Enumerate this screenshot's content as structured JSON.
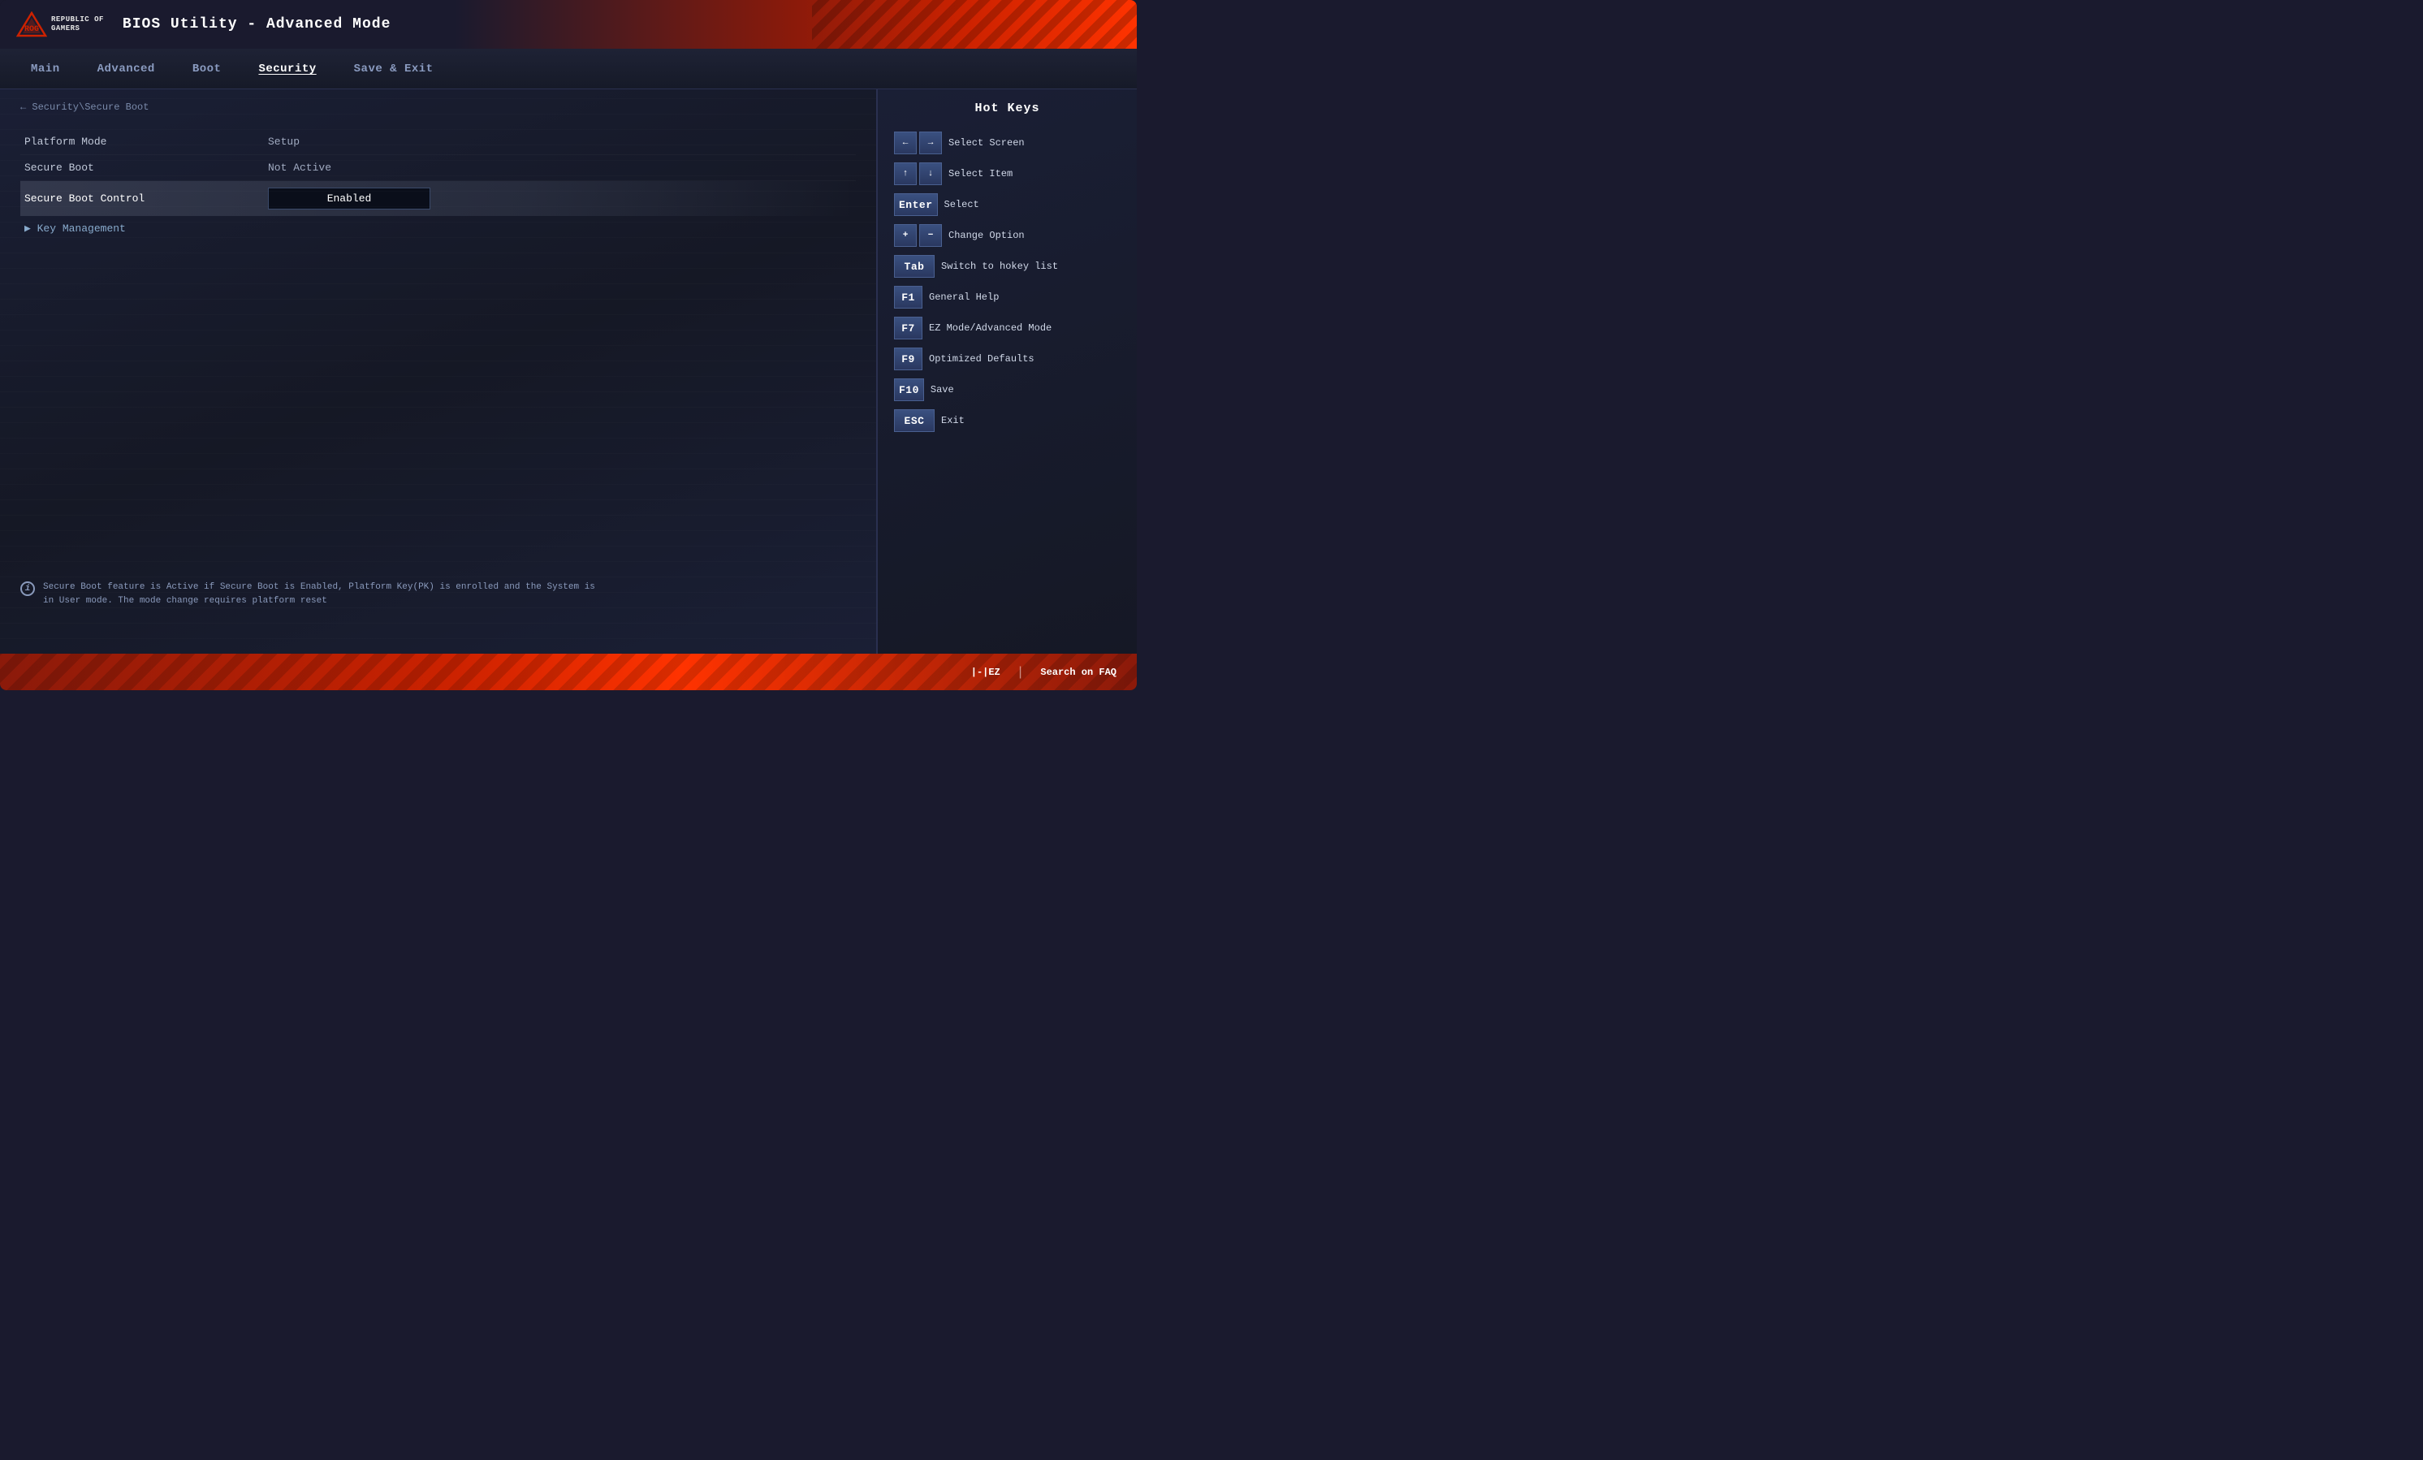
{
  "header": {
    "logo_text": "REPUBLIC OF\nGAMERS",
    "title": "BIOS Utility - Advanced Mode"
  },
  "navbar": {
    "items": [
      {
        "id": "main",
        "label": "Main",
        "active": false
      },
      {
        "id": "advanced",
        "label": "Advanced",
        "active": false
      },
      {
        "id": "boot",
        "label": "Boot",
        "active": false
      },
      {
        "id": "security",
        "label": "Security",
        "active": true
      },
      {
        "id": "save-exit",
        "label": "Save & Exit",
        "active": false
      }
    ]
  },
  "content": {
    "breadcrumb": "← Security\\Secure Boot",
    "settings": [
      {
        "label": "Platform Mode",
        "value": "Setup",
        "selected": false,
        "has_box": false
      },
      {
        "label": "Secure Boot",
        "value": "Not Active",
        "selected": false,
        "has_box": false
      },
      {
        "label": "Secure Boot Control",
        "value": "Enabled",
        "selected": true,
        "has_box": true
      }
    ],
    "submenu": {
      "label": "▶ Key Management"
    },
    "info_text": "Secure Boot feature is Active if Secure Boot is Enabled,\nPlatform Key(PK) is enrolled and the System is in User mode.\nThe mode change requires platform reset"
  },
  "hotkeys": {
    "title": "Hot Keys",
    "items": [
      {
        "key": "←→",
        "description": "Select Screen",
        "type": "arrow-pair"
      },
      {
        "key": "↑↓",
        "description": "Select Item",
        "type": "arrow-pair"
      },
      {
        "key": "Enter",
        "description": "Select",
        "type": "single-wide"
      },
      {
        "key": "+-",
        "description": "Change Option",
        "type": "plus-minus"
      },
      {
        "key": "Tab",
        "description": "Switch to hokey list",
        "type": "single-wide"
      },
      {
        "key": "F1",
        "description": "General Help",
        "type": "single"
      },
      {
        "key": "F7",
        "description": "EZ Mode/Advanced Mode",
        "type": "single"
      },
      {
        "key": "F9",
        "description": "Optimized Defaults",
        "type": "single"
      },
      {
        "key": "F10",
        "description": "Save",
        "type": "single"
      },
      {
        "key": "ESC",
        "description": "Exit",
        "type": "single-wide"
      }
    ]
  },
  "footer": {
    "ez_label": "|-|EZ",
    "divider": "|",
    "search_label": "Search on FAQ"
  }
}
